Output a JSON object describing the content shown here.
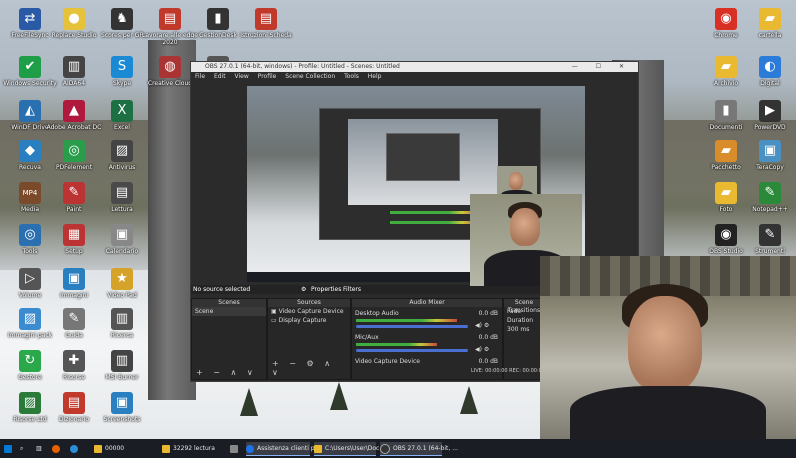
{
  "desktop": {
    "icons": [
      {
        "label": "FreeFileSync",
        "glyph": "⇄",
        "color": "#2a5aa5"
      },
      {
        "label": "Replace Studio",
        "glyph": "●",
        "color": "#e6c23a"
      },
      {
        "label": "Scores per GP",
        "glyph": "♞",
        "color": "#333"
      },
      {
        "label": "Lavorare alle edge 2020",
        "glyph": "▤",
        "color": "#c0392b"
      },
      {
        "label": "GestionDesk",
        "glyph": "▮",
        "color": "#333"
      },
      {
        "label": "Istruzioni Scheda",
        "glyph": "▤",
        "color": "#c0392b"
      },
      {
        "label": "Chrome",
        "glyph": "◉",
        "color": "#d93025"
      },
      {
        "label": "cartella",
        "glyph": "▰",
        "color": "#e8b931"
      },
      {
        "label": "Windows Security",
        "glyph": "✔",
        "color": "#1e9e46"
      },
      {
        "label": "AIDA64",
        "glyph": "▥",
        "color": "#444"
      },
      {
        "label": "Skype",
        "glyph": "S",
        "color": "#1a8ad4"
      },
      {
        "label": "Creative Cloud",
        "glyph": "◍",
        "color": "#a33"
      },
      {
        "label": "SDS Update",
        "glyph": "▦",
        "color": "#555"
      },
      {
        "label": "Archivio",
        "glyph": "▰",
        "color": "#e8b931"
      },
      {
        "label": "Digital",
        "glyph": "◐",
        "color": "#2b7bd8"
      },
      {
        "label": "WinDF Drive",
        "glyph": "◭",
        "color": "#2a6fb0"
      },
      {
        "label": "Adobe Acrobat DC",
        "glyph": "▲",
        "color": "#b0183d"
      },
      {
        "label": "Excel",
        "glyph": "X",
        "color": "#1d7044"
      },
      {
        "label": "Documenti",
        "glyph": "▮",
        "color": "#777"
      },
      {
        "label": "PowerDVD",
        "glyph": "▶",
        "color": "#333"
      },
      {
        "label": "Recuva",
        "glyph": "◆",
        "color": "#2a7fc0"
      },
      {
        "label": "PDFelement",
        "glyph": "◎",
        "color": "#2a9d4a"
      },
      {
        "label": "Antivirus",
        "glyph": "▨",
        "color": "#444"
      },
      {
        "label": "Pacchetto",
        "glyph": "▰",
        "color": "#d98c2a"
      },
      {
        "label": "TeraCopy",
        "glyph": "▣",
        "color": "#4a90c2"
      },
      {
        "label": "Media",
        "glyph": "MP4",
        "color": "#7b4a2a"
      },
      {
        "label": "Paint",
        "glyph": "✎",
        "color": "#b33"
      },
      {
        "label": "Lettura",
        "glyph": "▤",
        "color": "#4a4a4a"
      },
      {
        "label": "Foto",
        "glyph": "▰",
        "color": "#e8b931"
      },
      {
        "label": "Notepad++",
        "glyph": "✎",
        "color": "#2a8a3a"
      },
      {
        "label": "Tools",
        "glyph": "◎",
        "color": "#2a6fb0"
      },
      {
        "label": "Setup",
        "glyph": "▦",
        "color": "#b33"
      },
      {
        "label": "Calendario",
        "glyph": "▣",
        "color": "#888"
      },
      {
        "label": "OBS Studio",
        "glyph": "◉",
        "color": "#222"
      },
      {
        "label": "Strumenti",
        "glyph": "✎",
        "color": "#333"
      },
      {
        "label": "Volume",
        "glyph": "▷",
        "color": "#555"
      },
      {
        "label": "Immagini",
        "glyph": "▣",
        "color": "#2a7fc0"
      },
      {
        "label": "Video Pad",
        "glyph": "★",
        "color": "#d6a32a"
      },
      {
        "label": "Immagini pack",
        "glyph": "▨",
        "color": "#3b8bd0"
      },
      {
        "label": "Guida",
        "glyph": "✎",
        "color": "#777"
      },
      {
        "label": "Ricerca",
        "glyph": "▥",
        "color": "#555"
      },
      {
        "label": "Gestore",
        "glyph": "↻",
        "color": "#2aa84a"
      },
      {
        "label": "Risorse",
        "glyph": "✚",
        "color": "#555"
      },
      {
        "label": "MSI Burner",
        "glyph": "▥",
        "color": "#444"
      },
      {
        "label": "Risorse Ltd",
        "glyph": "▨",
        "color": "#2a7a3a"
      },
      {
        "label": "Dizionario",
        "glyph": "▤",
        "color": "#c0392b"
      },
      {
        "label": "Screenshots",
        "glyph": "▣",
        "color": "#2a7fc0"
      }
    ]
  },
  "obs": {
    "title": "OBS 27.0.1 (64-bit, windows) - Profile: Untitled - Scenes: Untitled",
    "window_controls": "— ☐ ✕",
    "menu": [
      "File",
      "Edit",
      "View",
      "Profile",
      "Scene Collection",
      "Tools",
      "Help"
    ],
    "no_source": "No source selected",
    "properties_label": "Properties",
    "filters_label": "Filters",
    "scenes": {
      "title": "Scenes",
      "items": [
        "Scene"
      ]
    },
    "sources": {
      "title": "Sources",
      "items": [
        "Video Capture Device",
        "Display Capture"
      ]
    },
    "mixer": {
      "title": "Audio Mixer",
      "channels": [
        {
          "name": "Desktop Audio",
          "db": "0.0 dB",
          "level": 0.72
        },
        {
          "name": "Mic/Aux",
          "db": "0.0 dB",
          "level": 0.58
        },
        {
          "name": "Video Capture Device",
          "db": "0.0 dB",
          "level": 0.0
        }
      ]
    },
    "transitions": {
      "title": "Scene Transitions",
      "type": "Fade",
      "duration_label": "Duration",
      "duration": "300 ms"
    },
    "stats": "LIVE: 00:00:00  REC: 00:00:09"
  },
  "taskbar": {
    "items": [
      {
        "label": "00000",
        "color": "#e8b931"
      },
      {
        "label": "32292 lectura",
        "color": "#e8b931"
      },
      {
        "label": "Assistenza clienti pr...",
        "color": "#1a73e8"
      },
      {
        "label": "C:\\Users\\User\\Doc...",
        "color": "#e8b931"
      },
      {
        "label": "OBS 27.0.1 (64-bit, ...",
        "color": "#333"
      }
    ]
  }
}
